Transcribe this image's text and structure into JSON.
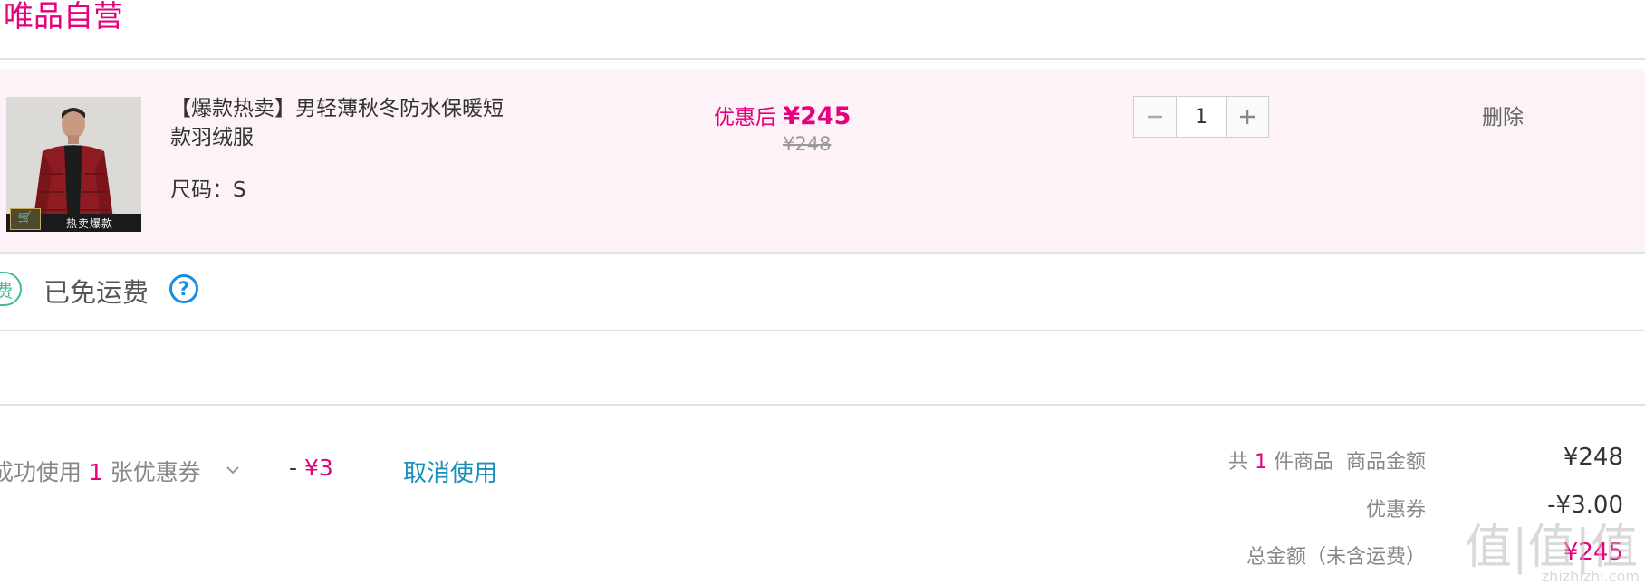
{
  "store": {
    "name": "唯品自营"
  },
  "item": {
    "title": "【爆款热卖】男轻薄秋冬防水保暖短款羽绒服",
    "thumb_badge": "热卖爆款",
    "size_label": "尺码：",
    "size_value": "S",
    "price_after_label": "优惠后 ",
    "price_currency": "¥",
    "price_after_value": "245",
    "price_original": "¥248",
    "quantity": "1",
    "minus_icon": "minus-icon",
    "plus_icon": "plus-icon",
    "delete_label": "删除"
  },
  "shipping": {
    "badge": "费",
    "text": "已免运费",
    "help_icon": "question-circle-icon",
    "help_glyph": "?"
  },
  "coupon": {
    "prefix": "成功使用 ",
    "count": "1",
    "suffix": " 张优惠券",
    "chevron_icon": "chevron-down-icon",
    "amount_prefix": "- ",
    "amount": "¥3",
    "cancel_label": "取消使用"
  },
  "summary": {
    "count_prefix": "共 ",
    "count": "1",
    "count_suffix": " 件商品",
    "goods_amount_label": "商品金额",
    "goods_amount": "¥248",
    "coupon_label": "优惠券",
    "coupon_value": "-¥3.00",
    "total_label": "总金额（未含运费）",
    "total_value": "¥245"
  },
  "watermark": {
    "big": "值|值|值",
    "small": "zhizhizhi.com"
  },
  "colors": {
    "brand": "#e6007e",
    "row_background": "#fcf2f8",
    "link": "#1a8fb8",
    "free_shipping": "#3bbf8c",
    "help": "#1a8fe0"
  }
}
